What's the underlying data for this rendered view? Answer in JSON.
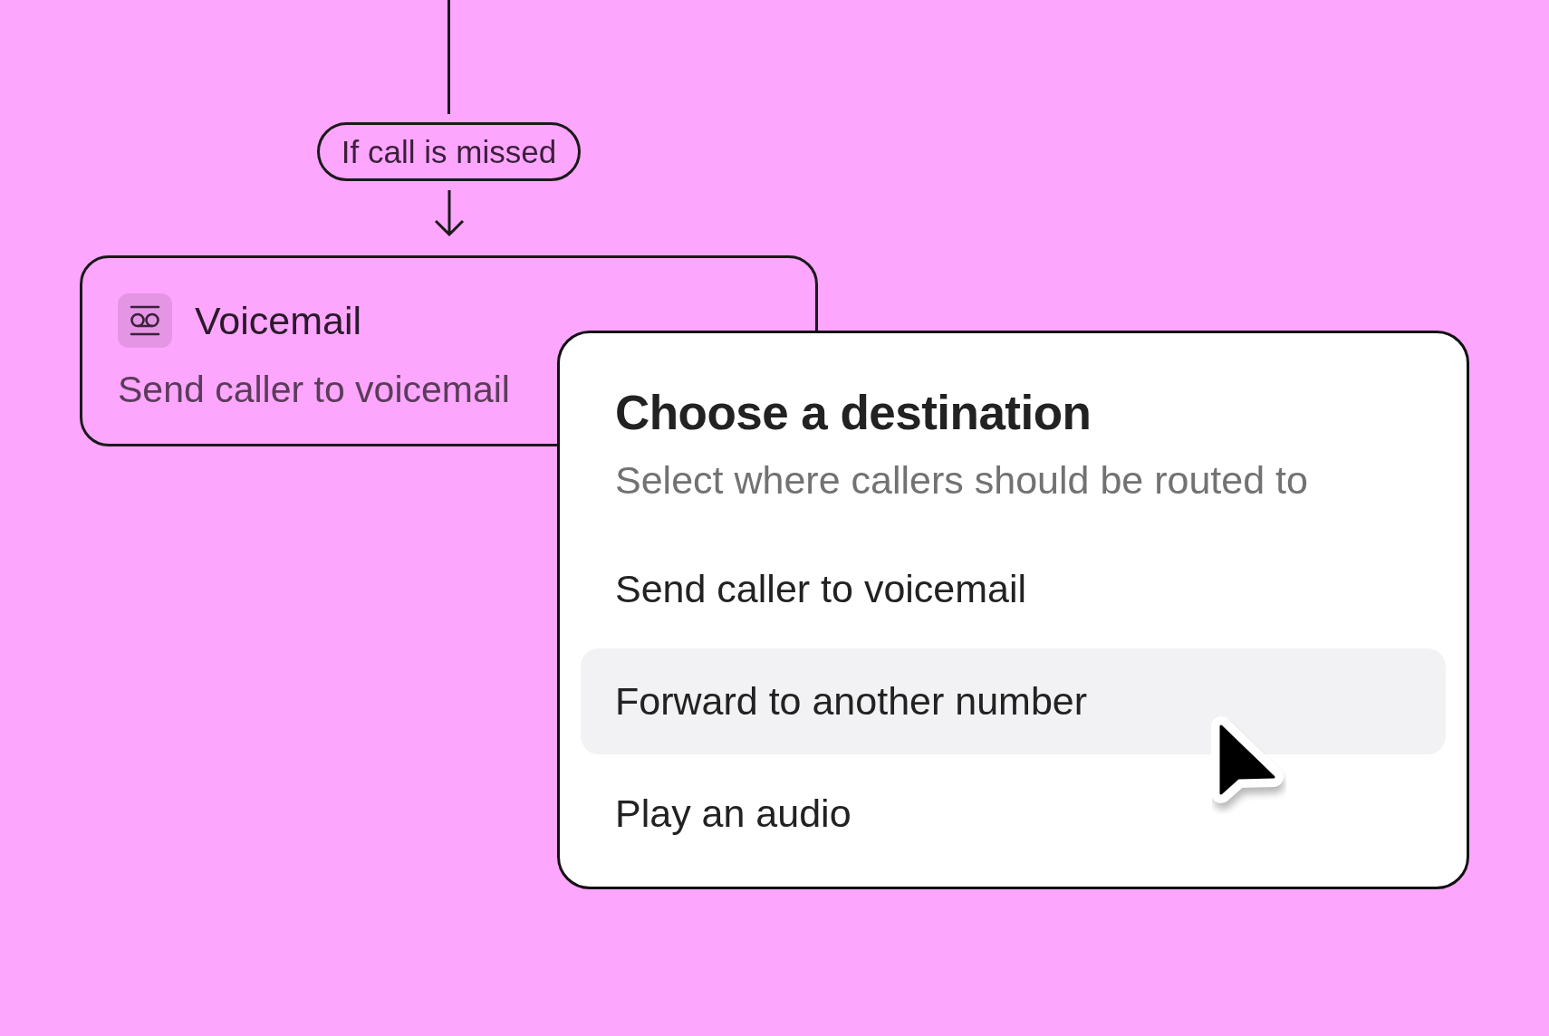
{
  "flow": {
    "condition": "If call is missed",
    "node": {
      "title": "Voicemail",
      "description": "Send caller to voicemail"
    }
  },
  "dialog": {
    "title": "Choose a destination",
    "subtitle": "Select where callers should be routed to",
    "options": [
      {
        "label": "Send caller to voicemail",
        "selected": false
      },
      {
        "label": "Forward to another number",
        "selected": true
      },
      {
        "label": "Play an audio",
        "selected": false
      }
    ]
  }
}
